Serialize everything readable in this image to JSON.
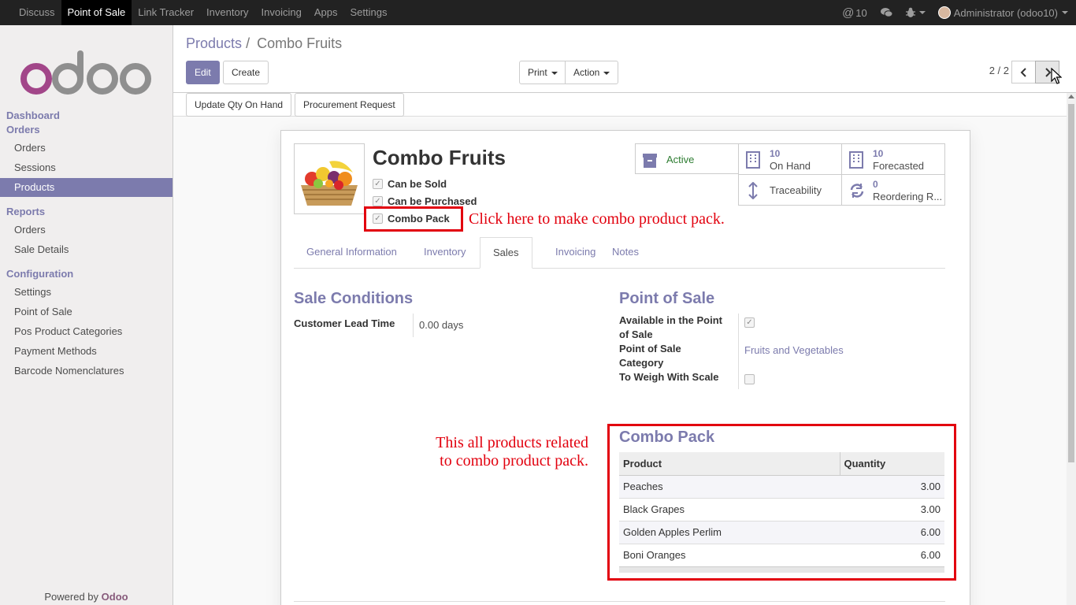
{
  "topbar": {
    "menu": [
      "Discuss",
      "Point of Sale",
      "Link Tracker",
      "Inventory",
      "Invoicing",
      "Apps",
      "Settings"
    ],
    "active_menu": "Point of Sale",
    "mentions_count": "10",
    "user": "Administrator (odoo10)",
    "icons": [
      "at-icon",
      "chat-icon",
      "bug-icon",
      "avatar"
    ]
  },
  "sidebar": {
    "logo": "odoo",
    "sections": {
      "dashboard": "Dashboard",
      "orders": "Orders",
      "reports": "Reports",
      "configuration": "Configuration"
    },
    "orders_items": [
      "Orders",
      "Sessions",
      "Products"
    ],
    "reports_items": [
      "Orders",
      "Sale Details"
    ],
    "config_items": [
      "Settings",
      "Point of Sale",
      "Pos Product Categories",
      "Payment Methods",
      "Barcode Nomenclatures"
    ],
    "active_item": "Products",
    "powered_by": "Powered by",
    "powered_brand": "Odoo"
  },
  "control_panel": {
    "breadcrumb_parent": "Products",
    "breadcrumb_sep": "/",
    "breadcrumb_current": "Combo Fruits",
    "edit_label": "Edit",
    "create_label": "Create",
    "print_label": "Print",
    "action_label": "Action",
    "pager": "2 / 2"
  },
  "statusbar": {
    "update_qty": "Update Qty On Hand",
    "procurement": "Procurement Request"
  },
  "product": {
    "name": "Combo Fruits",
    "can_be_sold": "Can be Sold",
    "can_be_purchased": "Can be Purchased",
    "combo_pack": "Combo Pack"
  },
  "stats": {
    "active": "Active",
    "on_hand_num": "10",
    "on_hand_label": "On Hand",
    "forecasted_num": "10",
    "forecasted_label": "Forecasted",
    "traceability": "Traceability",
    "reordering_num": "0",
    "reordering_label": "Reordering R..."
  },
  "tabs": [
    "General Information",
    "Inventory",
    "Sales",
    "Invoicing",
    "Notes"
  ],
  "active_tab": "Sales",
  "sale_conditions": {
    "title": "Sale Conditions",
    "lead_time_label": "Customer Lead Time",
    "lead_time_value": "0.00 days"
  },
  "pos": {
    "title": "Point of Sale",
    "available_label_1": "Available in the Point",
    "available_label_2": "of Sale",
    "category_label_1": "Point of Sale",
    "category_label_2": "Category",
    "category_value": "Fruits and Vegetables",
    "weigh_label": "To Weigh With Scale"
  },
  "combo": {
    "title": "Combo Pack",
    "col_product": "Product",
    "col_quantity": "Quantity",
    "rows": [
      {
        "product": "Peaches",
        "quantity": "3.00"
      },
      {
        "product": "Black Grapes",
        "quantity": "3.00"
      },
      {
        "product": "Golden Apples Perlim",
        "quantity": "6.00"
      },
      {
        "product": "Boni Oranges",
        "quantity": "6.00"
      }
    ]
  },
  "annotations": {
    "combo_hint": "Click here to make combo product pack.",
    "products_hint_1": "This all products related",
    "products_hint_2": "to combo product pack."
  },
  "colors": {
    "accent": "#7c7bad",
    "annotation_red": "#e2000e",
    "topbar": "#222222",
    "active_status": "#2e7d32"
  }
}
